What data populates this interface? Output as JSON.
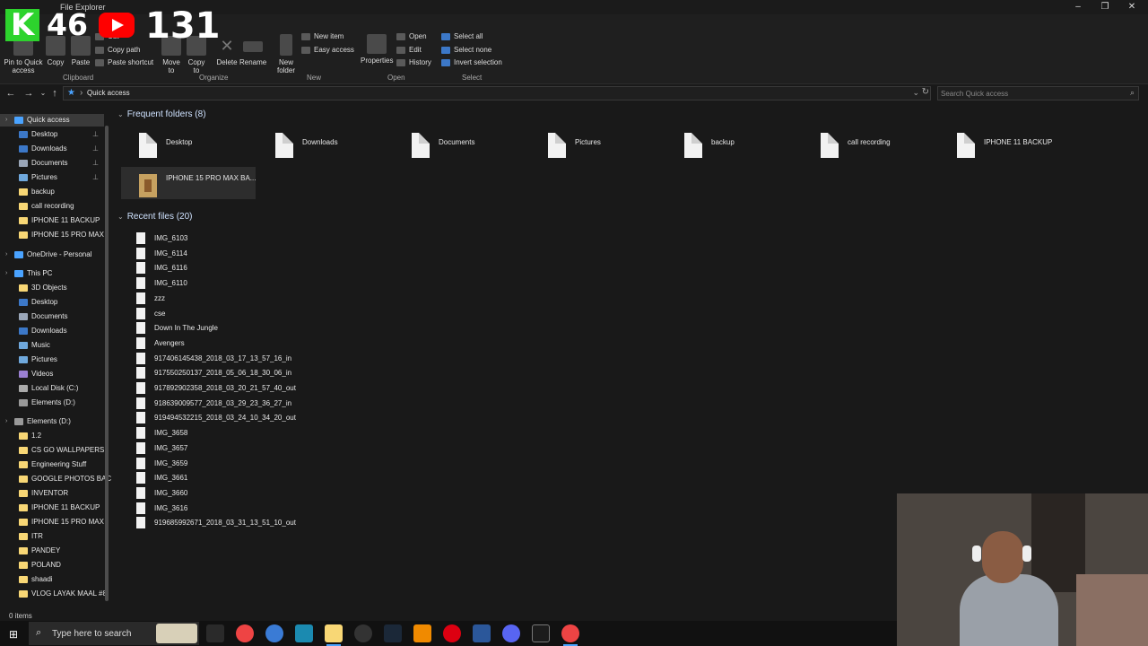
{
  "window": {
    "title": "File Explorer",
    "controls": [
      "–",
      "❐",
      "✕"
    ]
  },
  "overlay": {
    "kick_count": "46",
    "youtube_count": "131",
    "k_letter": "K"
  },
  "ribbon": {
    "clipboard": {
      "pin_label": "Pin to Quick access",
      "copy_label": "Copy",
      "paste_label": "Paste",
      "cut_label": "Cut",
      "copy_path_label": "Copy path",
      "paste_shortcut_label": "Paste shortcut",
      "group_label": "Clipboard"
    },
    "organize": {
      "move_to_label": "Move to",
      "copy_to_label": "Copy to",
      "delete_label": "Delete",
      "rename_label": "Rename",
      "group_label": "Organize"
    },
    "new": {
      "new_folder_label": "New folder",
      "new_item_label": "New item",
      "easy_access_label": "Easy access",
      "group_label": "New"
    },
    "open": {
      "properties_label": "Properties",
      "open_label": "Open",
      "edit_label": "Edit",
      "history_label": "History",
      "group_label": "Open"
    },
    "select": {
      "select_all_label": "Select all",
      "select_none_label": "Select none",
      "invert_selection_label": "Invert selection",
      "group_label": "Select"
    }
  },
  "address": {
    "path": "Quick access",
    "search_placeholder": "Search Quick access"
  },
  "sidebar": {
    "quick_access": "Quick access",
    "quick_items": [
      {
        "label": "Desktop",
        "pinned": true,
        "icon": "desktop"
      },
      {
        "label": "Downloads",
        "pinned": true,
        "icon": "downloads"
      },
      {
        "label": "Documents",
        "pinned": true,
        "icon": "documents"
      },
      {
        "label": "Pictures",
        "pinned": true,
        "icon": "pictures"
      },
      {
        "label": "backup",
        "pinned": false,
        "icon": "folder"
      },
      {
        "label": "call recording",
        "pinned": false,
        "icon": "folder"
      },
      {
        "label": "IPHONE 11 BACKUP",
        "pinned": false,
        "icon": "folder"
      },
      {
        "label": "IPHONE 15 PRO MAX",
        "pinned": false,
        "icon": "folder"
      }
    ],
    "onedrive": "OneDrive - Personal",
    "this_pc": "This PC",
    "pc_items": [
      "3D Objects",
      "Desktop",
      "Documents",
      "Downloads",
      "Music",
      "Pictures",
      "Videos",
      "Local Disk (C:)",
      "Elements (D:)"
    ],
    "elements_drive": "Elements (D:)",
    "drive_items": [
      "1.2",
      "CS GO WALLPAPERS",
      "Engineering Stuff",
      "GOOGLE PHOTOS BAC",
      "INVENTOR",
      "IPHONE 11 BACKUP",
      "IPHONE 15 PRO MAX",
      "ITR",
      "PANDEY",
      "POLAND",
      "shaadi",
      "VLOG LAYAK MAAL #8"
    ]
  },
  "main": {
    "frequent_header": "Frequent folders (8)",
    "frequent": [
      "Desktop",
      "Downloads",
      "Documents",
      "Pictures",
      "backup",
      "call recording",
      "IPHONE 11 BACKUP",
      "IPHONE 15 PRO MAX BA..."
    ],
    "recent_header": "Recent files (20)",
    "recent": [
      "IMG_6103",
      "IMG_6114",
      "IMG_6116",
      "IMG_6110",
      "zzz",
      "cse",
      "Down In The Jungle",
      "Avengers",
      "917406145438_2018_03_17_13_57_16_in",
      "917550250137_2018_05_06_18_30_06_in",
      "917892902358_2018_03_20_21_57_40_out",
      "918639009577_2018_03_29_23_36_27_in",
      "919494532215_2018_03_24_10_34_20_out",
      "IMG_3658",
      "IMG_3657",
      "IMG_3659",
      "IMG_3661",
      "IMG_3660",
      "IMG_3616",
      "919685992671_2018_03_31_13_51_10_out"
    ]
  },
  "status": {
    "items": "0 items"
  },
  "taskbar": {
    "search_placeholder": "Type here to search"
  },
  "colors": {
    "accent": "#4aa3ff",
    "folder": "#f8d775",
    "background": "#191919"
  }
}
